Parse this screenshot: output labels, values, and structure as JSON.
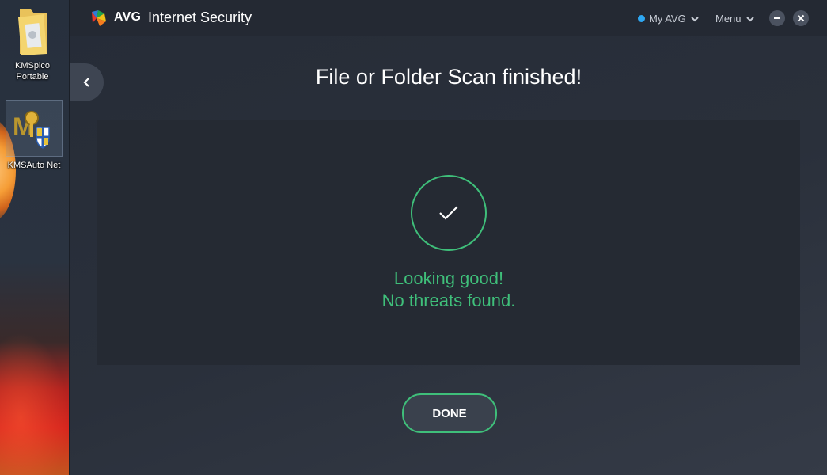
{
  "desktop": {
    "icons": [
      {
        "label": "KMSpico Portable"
      },
      {
        "label": "KMSAuto Net"
      }
    ]
  },
  "window": {
    "brand": "AVG",
    "product": "Internet Security",
    "my_avg": "My AVG",
    "menu": "Menu"
  },
  "scan": {
    "title": "File or Folder Scan finished!",
    "status_line1": "Looking good!",
    "status_line2": "No threats found.",
    "done_label": "DONE"
  },
  "colors": {
    "accent_green": "#3fbf7a",
    "status_dot_blue": "#2ea7f2",
    "background": "#2a303b"
  },
  "icons": [
    "folder-icon",
    "kmsauto-icon",
    "avg-logo-icon",
    "chevron-down-icon",
    "minimize-icon",
    "close-icon",
    "back-arrow-icon",
    "checkmark-icon"
  ]
}
